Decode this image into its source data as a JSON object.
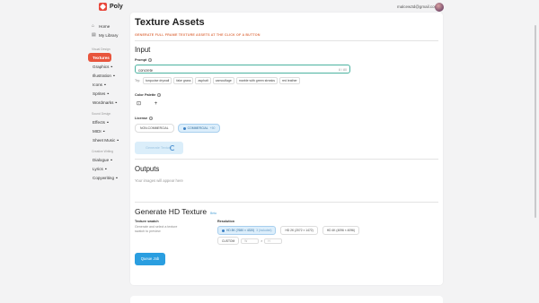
{
  "app": {
    "name": "Poly"
  },
  "user": {
    "email": "malcew3d@gmail.com"
  },
  "sidebar": {
    "top": [
      {
        "label": "Home",
        "icon": "home-icon"
      },
      {
        "label": "My Library",
        "icon": "library-icon"
      }
    ],
    "sections": [
      {
        "title": "Visual Design",
        "items": [
          {
            "label": "Textures",
            "locked": false,
            "active": true
          },
          {
            "label": "Graphics",
            "locked": true
          },
          {
            "label": "Illustration",
            "locked": true
          },
          {
            "label": "Icons",
            "locked": true
          },
          {
            "label": "Sprites",
            "locked": true
          },
          {
            "label": "Wordmarks",
            "locked": true
          }
        ]
      },
      {
        "title": "Sound Design",
        "items": [
          {
            "label": "Effects",
            "locked": true
          },
          {
            "label": "MIDI",
            "locked": true
          },
          {
            "label": "Sheet Music",
            "locked": true
          }
        ]
      },
      {
        "title": "Creative Writing",
        "items": [
          {
            "label": "Dialogue",
            "locked": true
          },
          {
            "label": "Lyrics",
            "locked": true
          },
          {
            "label": "Copywriting",
            "locked": true
          }
        ]
      }
    ]
  },
  "page": {
    "title": "Texture Assets",
    "subtitle": "GENERATE FULL FRAME TEXTURE ASSETS AT THE CLICK OF A BUTTON"
  },
  "input": {
    "heading": "Input",
    "prompt_label": "Prompt",
    "prompt_value": "concrete",
    "prompt_counter": "8 / 80",
    "try_label": "Try:",
    "suggestions": [
      "turquoise drywall",
      "fake grass",
      "asphalt",
      "camouflage",
      "marble with green streaks",
      "red leather"
    ],
    "palette_label": "Color Palette",
    "license_label": "License",
    "license_options": [
      {
        "label": "NON-COMMERCIAL",
        "selected": false,
        "fee": ""
      },
      {
        "label": "COMMERCIAL",
        "selected": true,
        "fee": "+50"
      }
    ],
    "generate_label": "Generate Texture"
  },
  "outputs": {
    "heading": "Outputs",
    "empty_text": "Your images will appear here"
  },
  "hd": {
    "heading": "Generate HD Texture",
    "badge": "Beta",
    "swatch_label": "Texture swatch",
    "swatch_desc": "Generate and select a texture swatch to preview",
    "resolution_label": "Resolution",
    "resolutions": [
      {
        "label": "HD 8K (7680 × 4320)",
        "note": "3 (included)",
        "selected": true
      },
      {
        "label": "HD 2K (2072 × 1472)",
        "note": "",
        "selected": false
      },
      {
        "label": "HD 4K (4096 × 4096)",
        "note": "",
        "selected": false
      }
    ],
    "custom_label": "CUSTOM",
    "width_placeholder": "W",
    "height_placeholder": "H",
    "times": "×",
    "queue_label": "Queue Job"
  },
  "colors": {
    "accent": "#e8553d",
    "primary_button": "#2a9ee0",
    "subtitle": "#e07a52",
    "input_focus": "#4bb2a0"
  }
}
